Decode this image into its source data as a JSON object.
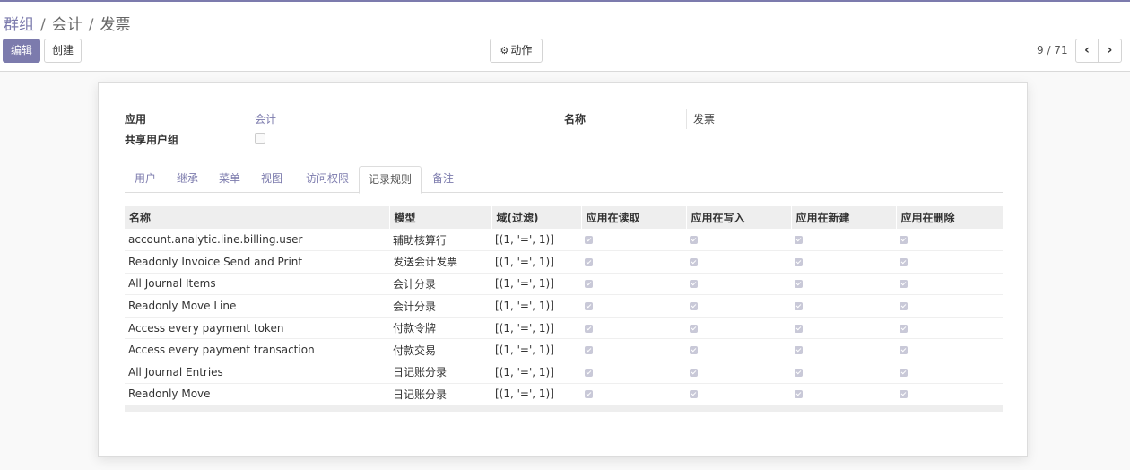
{
  "breadcrumb": {
    "items": [
      "群组",
      "会计",
      "发票"
    ],
    "separator": "/"
  },
  "toolbar": {
    "edit_label": "编辑",
    "create_label": "创建",
    "action_label": "动作",
    "action_icon": "gear-icon"
  },
  "pager": {
    "value": "9 / 71",
    "prev_icon": "chevron-left-icon",
    "next_icon": "chevron-right-icon"
  },
  "form": {
    "application_label": "应用",
    "application_value": "会计",
    "shared_label": "共享用户组",
    "shared_checked": false,
    "name_label": "名称",
    "name_value": "发票"
  },
  "tabs": [
    "用户",
    "继承",
    "菜单",
    "视图",
    "访问权限",
    "记录规则",
    "备注"
  ],
  "active_tab": "记录规则",
  "table": {
    "headers": [
      "名称",
      "模型",
      "域(过滤)",
      "应用在读取",
      "应用在写入",
      "应用在新建",
      "应用在删除"
    ],
    "rows": [
      {
        "name": "account.analytic.line.billing.user",
        "model": "辅助核算行",
        "domain": "[(1, '=', 1)]",
        "read": true,
        "write": true,
        "create": true,
        "unlink": true
      },
      {
        "name": "Readonly Invoice Send and Print",
        "model": "发送会计发票",
        "domain": "[(1, '=', 1)]",
        "read": true,
        "write": true,
        "create": true,
        "unlink": true
      },
      {
        "name": "All Journal Items",
        "model": "会计分录",
        "domain": "[(1, '=', 1)]",
        "read": true,
        "write": true,
        "create": true,
        "unlink": true
      },
      {
        "name": "Readonly Move Line",
        "model": "会计分录",
        "domain": "[(1, '=', 1)]",
        "read": true,
        "write": true,
        "create": true,
        "unlink": true
      },
      {
        "name": "Access every payment token",
        "model": "付款令牌",
        "domain": "[(1, '=', 1)]",
        "read": true,
        "write": true,
        "create": true,
        "unlink": true
      },
      {
        "name": "Access every payment transaction",
        "model": "付款交易",
        "domain": "[(1, '=', 1)]",
        "read": true,
        "write": true,
        "create": true,
        "unlink": true
      },
      {
        "name": "All Journal Entries",
        "model": "日记账分录",
        "domain": "[(1, '=', 1)]",
        "read": true,
        "write": true,
        "create": true,
        "unlink": true
      },
      {
        "name": "Readonly Move",
        "model": "日记账分录",
        "domain": "[(1, '=', 1)]",
        "read": true,
        "write": true,
        "create": true,
        "unlink": true
      }
    ]
  },
  "colors": {
    "accent": "#7c7bad",
    "header_bg": "#eeeeee",
    "checkbox": "#c9c9d8"
  }
}
